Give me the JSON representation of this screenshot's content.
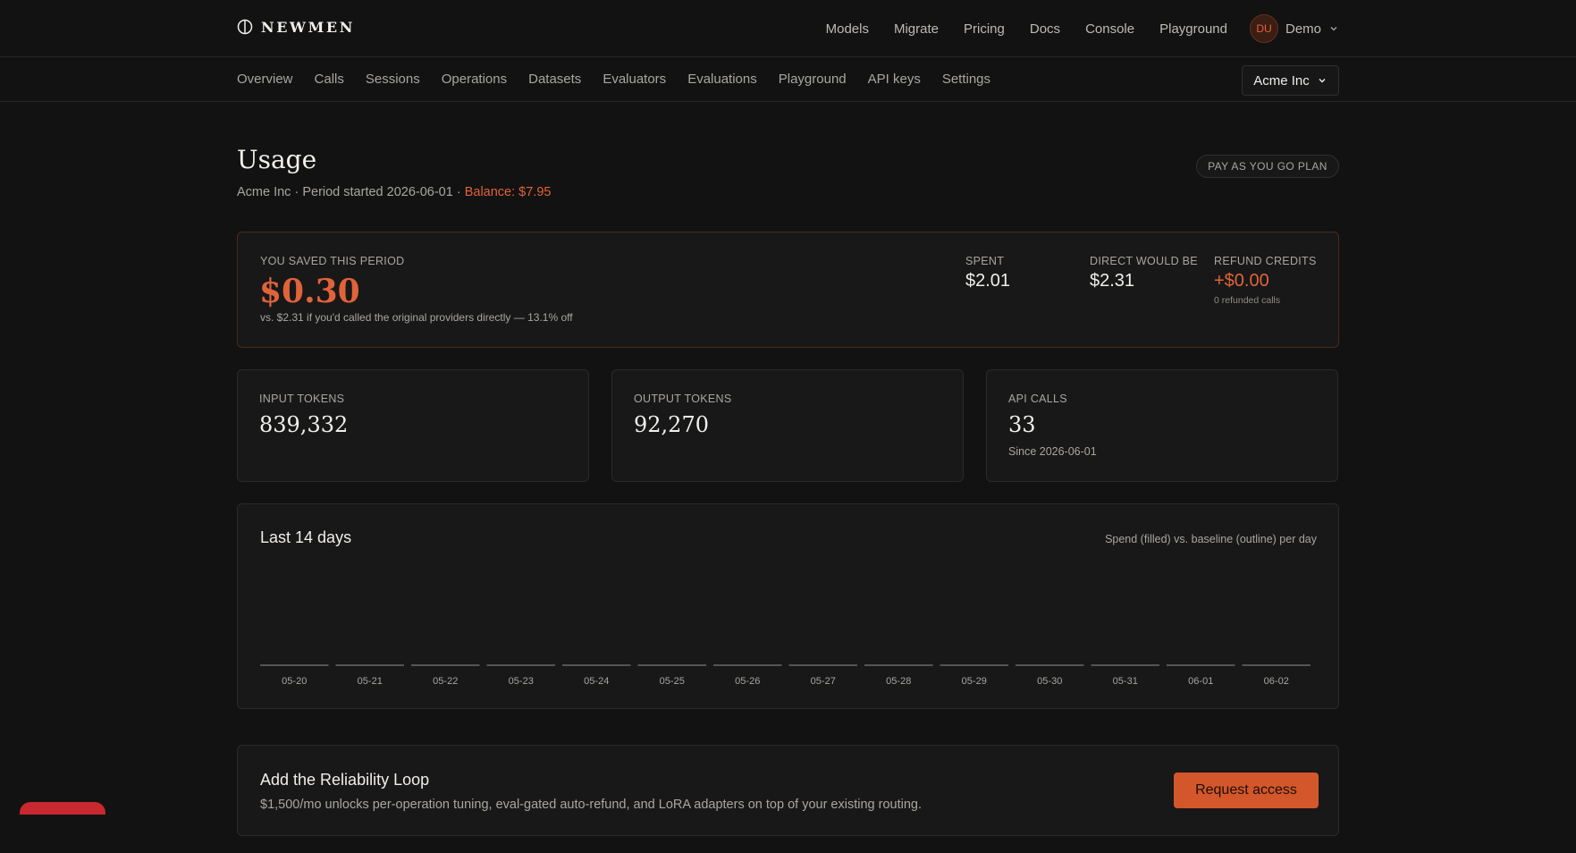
{
  "brand": {
    "name": "NEWMEN"
  },
  "topnav": {
    "items": [
      "Models",
      "Migrate",
      "Pricing",
      "Docs",
      "Console",
      "Playground"
    ],
    "user": {
      "initials": "DU",
      "name": "Demo"
    }
  },
  "subnav": {
    "items": [
      "Overview",
      "Calls",
      "Sessions",
      "Operations",
      "Datasets",
      "Evaluators",
      "Evaluations",
      "Playground",
      "API keys",
      "Settings"
    ],
    "org": "Acme Inc"
  },
  "header": {
    "title": "Usage",
    "org": "Acme Inc",
    "sep1": " · ",
    "period": "Period started 2026-06-01",
    "sep2": " · ",
    "balance": "Balance: $7.95",
    "plan_badge": "PAY AS YOU GO PLAN"
  },
  "savings": {
    "label": "YOU SAVED THIS PERIOD",
    "value": "$0.30",
    "note": "vs. $2.31 if you'd called the original providers directly — 13.1% off",
    "spent_label": "SPENT",
    "spent_value": "$2.01",
    "direct_label": "DIRECT WOULD BE",
    "direct_value": "$2.31",
    "refund_label": "REFUND CREDITS",
    "refund_value": "+$0.00",
    "refund_sub": "0 refunded calls"
  },
  "metrics": {
    "input": {
      "label": "INPUT TOKENS",
      "value": "839,332"
    },
    "output": {
      "label": "OUTPUT TOKENS",
      "value": "92,270"
    },
    "calls": {
      "label": "API CALLS",
      "value": "33",
      "sub": "Since 2026-06-01"
    }
  },
  "chart": {
    "title": "Last 14 days",
    "legend": "Spend (filled) vs. baseline (outline) per day"
  },
  "chart_data": {
    "type": "bar",
    "categories": [
      "05-20",
      "05-21",
      "05-22",
      "05-23",
      "05-24",
      "05-25",
      "05-26",
      "05-27",
      "05-28",
      "05-29",
      "05-30",
      "05-31",
      "06-01",
      "06-02"
    ],
    "series": [
      {
        "name": "Spend",
        "values": [
          0,
          0,
          0,
          0,
          0,
          0,
          0,
          0,
          0,
          0,
          0,
          0,
          0,
          0
        ]
      },
      {
        "name": "baseline",
        "values": [
          0,
          0,
          0,
          0,
          0,
          0,
          0,
          0,
          0,
          0,
          0,
          0,
          0,
          0
        ]
      }
    ],
    "title": "Last 14 days"
  },
  "promo": {
    "title": "Add the Reliability Loop",
    "desc": "$1,500/mo unlocks per-operation tuning, eval-gated auto-refund, and LoRA adapters on top of your existing routing.",
    "button": "Request access"
  },
  "colors": {
    "accent": "#e0633a",
    "button": "#d4572b",
    "background": "#121212",
    "card": "#181818"
  }
}
